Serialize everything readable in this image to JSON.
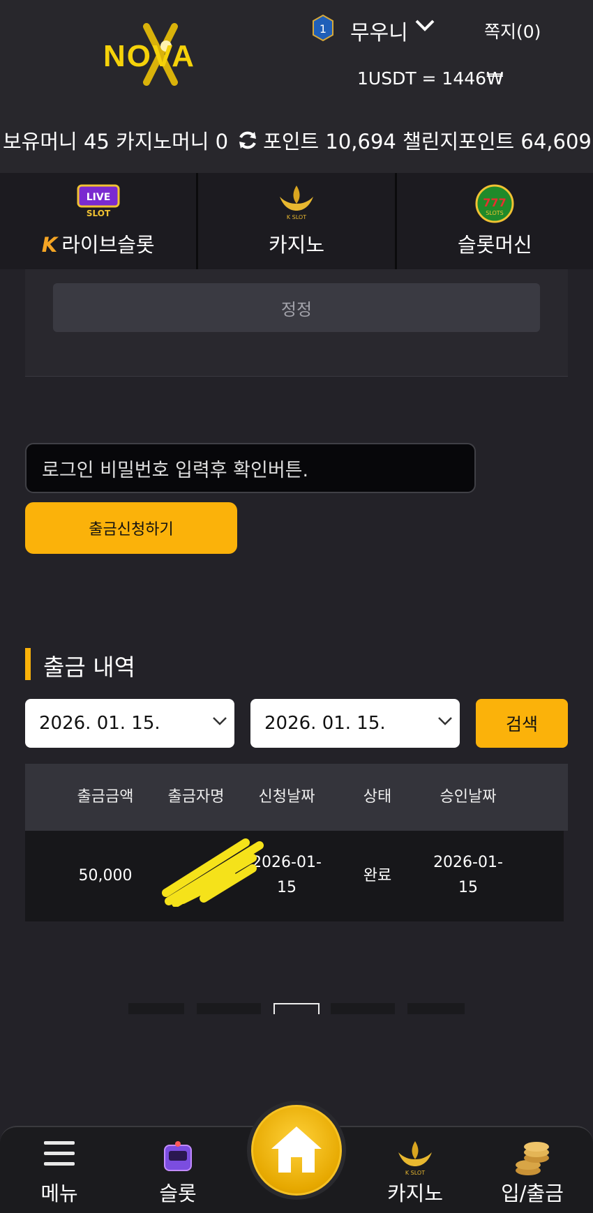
{
  "header": {
    "logo_text": "NOVA",
    "level": "1",
    "username": "무우니",
    "messages": "쪽지(0)",
    "rate": "1USDT = 1446₩"
  },
  "balances": {
    "money": "보유머니 45",
    "casino_money": "카지노머니 0",
    "points": "포인트 10,694",
    "challenge_points": "챌린지포인트 64,609"
  },
  "categories": [
    {
      "label": "라이브슬롯",
      "icon": "live-slot-icon",
      "badge": "K"
    },
    {
      "label": "카지노",
      "icon": "k-slot-icon"
    },
    {
      "label": "슬롯머신",
      "icon": "777-slots-icon"
    }
  ],
  "panel": {
    "correct_button": "정정"
  },
  "withdraw_form": {
    "password_placeholder": "로그인 비밀번호 입력후 확인버튼.",
    "submit_label": "출금신청하기"
  },
  "history": {
    "title": "출금 내역",
    "date_from": "2026. 01. 15.",
    "date_to": "2026. 01. 15.",
    "search_label": "검색",
    "columns": [
      "출금금액",
      "출금자명",
      "신청날짜",
      "상태",
      "승인날짜"
    ],
    "rows": [
      {
        "amount": "50,000",
        "name": "",
        "request_date_1": "2026-01-",
        "request_date_2": "15",
        "status": "완료",
        "approve_date_1": "2026-01-",
        "approve_date_2": "15"
      }
    ]
  },
  "bottom_nav": {
    "menu": "메뉴",
    "slot": "슬롯",
    "casino": "카지노",
    "deposit_withdraw": "입/출금"
  },
  "colors": {
    "accent": "#fbb20a",
    "logo": "#f5d20a",
    "background": "#232228"
  }
}
